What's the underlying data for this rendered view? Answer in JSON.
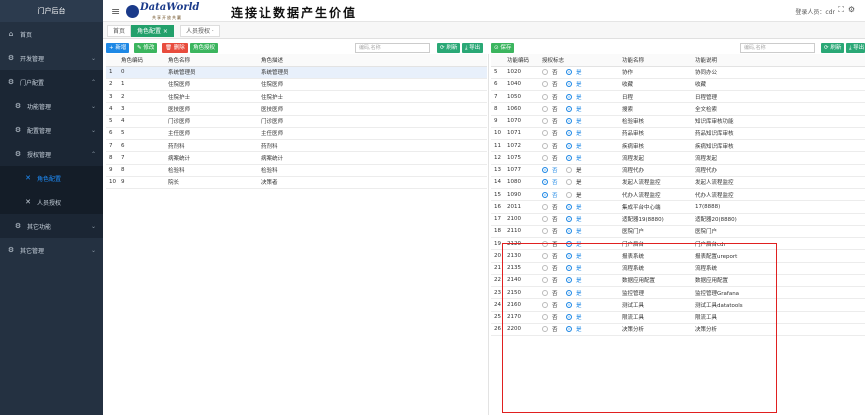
{
  "sidebar": {
    "logo": "门户后台",
    "items": [
      {
        "label": "首页",
        "icon": "home-icon"
      },
      {
        "label": "开发管理",
        "icon": "gear-icon"
      },
      {
        "label": "门户配置",
        "icon": "gear-icon"
      },
      {
        "label": "功能管理",
        "icon": "gear-icon"
      },
      {
        "label": "配置管理",
        "icon": "gear-icon"
      },
      {
        "label": "授权管理",
        "icon": "gear-icon"
      },
      {
        "label": "角色配置",
        "icon": "cross-tools-icon"
      },
      {
        "label": "人员授权",
        "icon": "cross-tools-icon"
      },
      {
        "label": "其它功能",
        "icon": "gear-icon"
      },
      {
        "label": "其它管理",
        "icon": "gear-icon"
      }
    ]
  },
  "header": {
    "brand_main": "DataWorld",
    "brand_sub": "共享开放共赢",
    "slogan": "连接让数据产生价值",
    "user_label": "登录人员：cdr"
  },
  "tabs": [
    {
      "label": "首页"
    },
    {
      "label": "角色配置 ×"
    },
    {
      "label": "人员授权 ·"
    }
  ],
  "left_toolbar": {
    "add": "+ 新增",
    "edit": "✎ 修改",
    "delete": "🗑 删除",
    "authorize": "角色授权",
    "search_placeholder": "编码,名称",
    "refresh": "⟳ 刷新",
    "export": "⤓ 导出"
  },
  "right_toolbar": {
    "save": "⊙ 保存",
    "search_placeholder": "编码,名称",
    "refresh": "⟳ 刷新",
    "export": "⤓ 导出"
  },
  "role_table": {
    "headers": [
      "",
      "角色编码",
      "角色名称",
      "角色描述"
    ],
    "rows": [
      [
        "1",
        "0",
        "系统管理员",
        "系统管理员"
      ],
      [
        "2",
        "1",
        "住院医师",
        "住院医师"
      ],
      [
        "3",
        "2",
        "住院护士",
        "住院护士"
      ],
      [
        "4",
        "3",
        "医技医师",
        "医技医师"
      ],
      [
        "5",
        "4",
        "门诊医师",
        "门诊医师"
      ],
      [
        "6",
        "5",
        "主任医师",
        "主任医师"
      ],
      [
        "7",
        "6",
        "药剂科",
        "药剂科"
      ],
      [
        "8",
        "7",
        "病案统计",
        "病案统计"
      ],
      [
        "9",
        "8",
        "检验科",
        "检验科"
      ],
      [
        "10",
        "9",
        "院长",
        "决策者"
      ]
    ]
  },
  "func_table": {
    "headers": [
      "",
      "功能编码",
      "授权标志",
      "功能名称",
      "功能说明"
    ],
    "no_label": "否",
    "yes_label": "是",
    "rows": [
      [
        "5",
        "1020",
        "yes",
        "协作",
        "协同办公"
      ],
      [
        "6",
        "1040",
        "yes",
        "收藏",
        "收藏"
      ],
      [
        "7",
        "1050",
        "yes",
        "日程",
        "日程管理"
      ],
      [
        "8",
        "1060",
        "yes",
        "搜索",
        "全文检索"
      ],
      [
        "9",
        "1070",
        "yes",
        "检验审核",
        "知识库审核功能"
      ],
      [
        "10",
        "1071",
        "yes",
        "药品审核",
        "药品知识库审核"
      ],
      [
        "11",
        "1072",
        "yes",
        "疾病审核",
        "疾病知识库审核"
      ],
      [
        "12",
        "1075",
        "yes",
        "流程发起",
        "流程发起"
      ],
      [
        "13",
        "1077",
        "no",
        "流程代办",
        "流程代办"
      ],
      [
        "14",
        "1080",
        "no",
        "发起人流程监控",
        "发起人流程监控"
      ],
      [
        "15",
        "1090",
        "no",
        "代办人流程监控",
        "代办人流程监控"
      ],
      [
        "16",
        "2011",
        "yes",
        "集成平台中心端",
        "17(8888)"
      ],
      [
        "17",
        "2100",
        "yes",
        "适配器19(8880)",
        "适配器20(8880)"
      ],
      [
        "18",
        "2110",
        "yes",
        "医院门户",
        "医院门户"
      ],
      [
        "19",
        "2120",
        "yes",
        "门户后台",
        "门户后台cdr"
      ],
      [
        "20",
        "2130",
        "yes",
        "报表系统",
        "报表配置ureport"
      ],
      [
        "21",
        "2135",
        "yes",
        "流程系统",
        "流程系统"
      ],
      [
        "22",
        "2140",
        "yes",
        "数据应用配置",
        "数据应用配置"
      ],
      [
        "23",
        "2150",
        "yes",
        "监控管理",
        "监控管理Grafana"
      ],
      [
        "24",
        "2160",
        "yes",
        "测试工具",
        "测试工具datatools"
      ],
      [
        "25",
        "2170",
        "yes",
        "限流工具",
        "限流工具"
      ],
      [
        "26",
        "2200",
        "yes",
        "决策分析",
        "决策分析"
      ]
    ]
  },
  "colors": {
    "sidebar_bg": "#243141",
    "accent_blue": "#1e88e5",
    "accent_green": "#3bb55e",
    "danger_red": "#e84c3d",
    "highlight_box": "#e02020"
  }
}
